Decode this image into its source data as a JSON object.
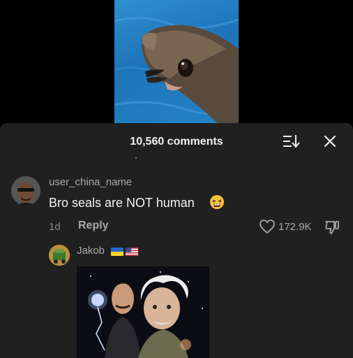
{
  "video": {
    "description_icon": "seal-video-frame"
  },
  "comments_panel": {
    "count_label": "10,560 comments",
    "icons": {
      "sort": "sort-icon",
      "close": "close-icon"
    }
  },
  "comment": {
    "username": "user_china_name",
    "text": "Bro seals are NOT human",
    "emoji": "tired-face-emoji",
    "time": "1d",
    "reply_label": "Reply",
    "like_count": "172.9K",
    "icons": {
      "like": "heart-icon",
      "dislike": "dislike-icon"
    }
  },
  "reply": {
    "username": "Jakob",
    "flags": [
      "ukraine-flag",
      "usa-flag"
    ]
  },
  "colors": {
    "sheet_bg": "#202021",
    "primary_text": "#f1f1f2",
    "secondary_text": "#a9a9ad",
    "muted_text": "#8a8a8e"
  }
}
